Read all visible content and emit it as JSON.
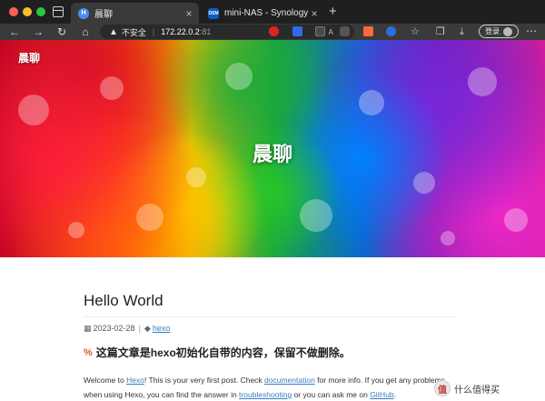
{
  "browser": {
    "tabs": [
      {
        "title": "晨聊",
        "active": true
      },
      {
        "title": "mini-NAS - Synology DiskStation",
        "active": false
      }
    ],
    "address": {
      "security_label": "不安全",
      "host": "172.22.0.2",
      "port": ":81"
    },
    "login_label": "登录",
    "icons": [
      "back-icon",
      "forward-icon",
      "reload-icon",
      "home-icon",
      "warning-icon",
      "read-aloud-icon",
      "favorite-icon",
      "split-icon",
      "bookmarks-icon",
      "collections-icon",
      "download-icon",
      "more-icon"
    ]
  },
  "site": {
    "name": "晨聊",
    "hero_title": "晨聊"
  },
  "post": {
    "title": "Hello World",
    "date": "2023-02-28",
    "tag": "hexo",
    "heading": "这篇文章是hexo初始化自带的内容，保留不做删除。",
    "paragraph": {
      "p1": "Welcome to ",
      "link1": "Hexo",
      "p2": "! This is your very first post. Check ",
      "link2": "documentation",
      "p3": " for more info. If you get any problems when using Hexo, you can find the answer in ",
      "link3": "troubleshooting",
      "p4": " or you can ask me on ",
      "link4": "GitHub",
      "p5": "."
    }
  },
  "watermark": {
    "badge": "值",
    "text": "什么值得买"
  },
  "colors": {
    "link": "#3a7fc0",
    "chrome_dark": "#1f1f1f",
    "toolbar": "#3a3a3a"
  }
}
